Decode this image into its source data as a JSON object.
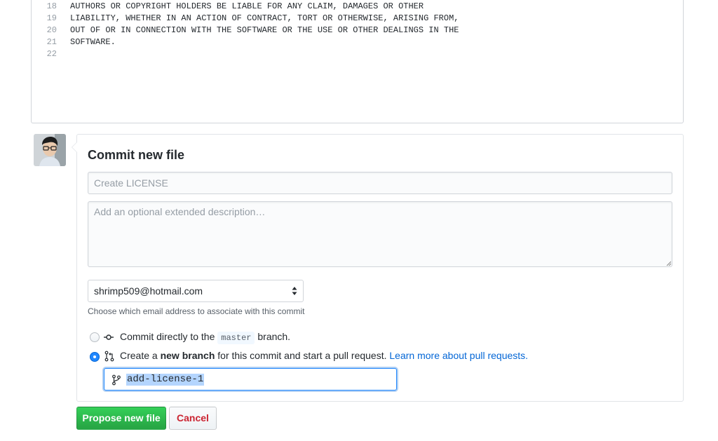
{
  "code": {
    "lines": [
      {
        "num": "18",
        "text": "AUTHORS OR COPYRIGHT HOLDERS BE LIABLE FOR ANY CLAIM, DAMAGES OR OTHER"
      },
      {
        "num": "19",
        "text": "LIABILITY, WHETHER IN AN ACTION OF CONTRACT, TORT OR OTHERWISE, ARISING FROM,"
      },
      {
        "num": "20",
        "text": "OUT OF OR IN CONNECTION WITH THE SOFTWARE OR THE USE OR OTHER DEALINGS IN THE"
      },
      {
        "num": "21",
        "text": "SOFTWARE."
      },
      {
        "num": "22",
        "text": ""
      }
    ]
  },
  "commit": {
    "title": "Commit new file",
    "summary_placeholder": "Create LICENSE",
    "description_placeholder": "Add an optional extended description…",
    "email_selected": "shrimp509@hotmail.com",
    "email_help": "Choose which email address to associate with this commit",
    "option_direct": {
      "prefix": "Commit directly to the",
      "branch": "master",
      "suffix": "branch."
    },
    "option_new_branch": {
      "prefix": "Create a",
      "bold": "new branch",
      "suffix": "for this commit and start a pull request.",
      "link": "Learn more about pull requests."
    },
    "branch_name": "add-license-1"
  },
  "buttons": {
    "propose": "Propose new file",
    "cancel": "Cancel"
  },
  "colors": {
    "primary_green": "#28a745",
    "cancel_red": "#cb2431",
    "link_blue": "#0366d6",
    "focus_blue": "#2188ff"
  }
}
